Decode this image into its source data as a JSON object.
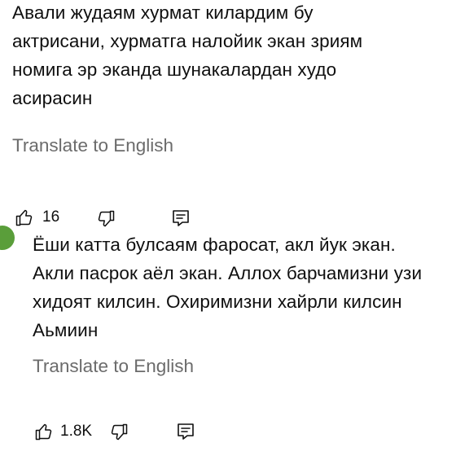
{
  "comments": [
    {
      "text": "Авали жудаям хурмат килардим бу\nактрисани, хурматга налойик экан зриям\nномига эр эканда шунакалардан худо\nасирасин",
      "translate_label": "Translate to English",
      "like_count": "16",
      "icons": {
        "like": "thumbs-up-icon",
        "dislike": "thumbs-down-icon",
        "reply": "reply-comment-icon"
      }
    },
    {
      "text": "Ёши катта булсаям фаросат, акл йук экан.\nАкли пасрок аёл экан. Аллох барчамизни узи\nхидоят килсин. Охиримизни хайрли килсин\nАьмиин",
      "translate_label": "Translate to English",
      "like_count": "1.8K",
      "icons": {
        "like": "thumbs-up-icon",
        "dislike": "thumbs-down-icon",
        "reply": "reply-comment-icon"
      }
    }
  ],
  "colors": {
    "text": "#0f0f0f",
    "translate": "#6b6b6b",
    "avatar": "#5a9e3a"
  }
}
